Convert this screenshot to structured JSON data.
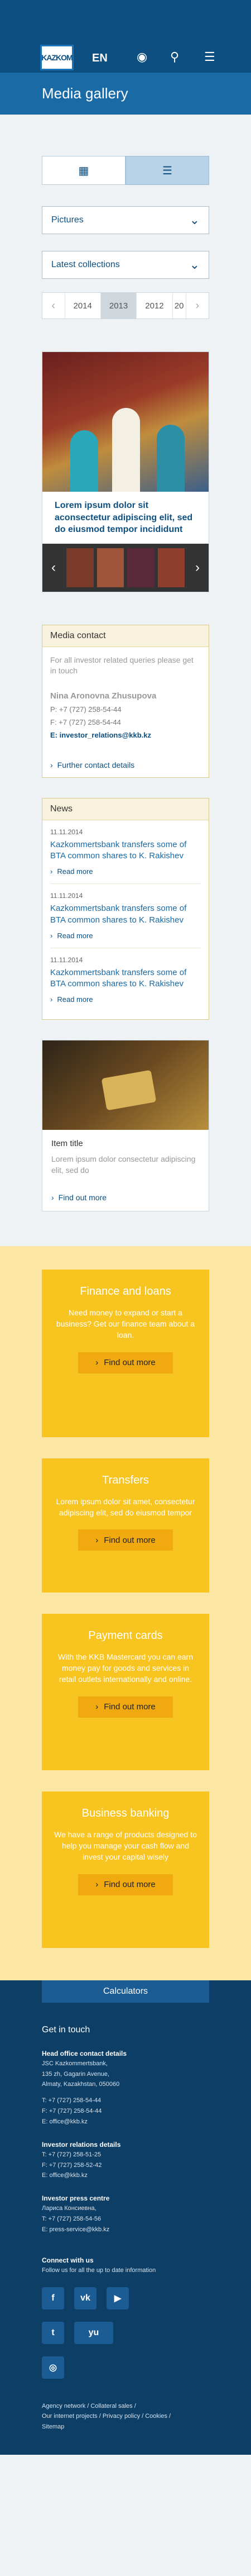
{
  "header": {
    "logo_text": "KAZKOM",
    "lang": "EN",
    "icons": [
      "map-pin-icon",
      "search-icon",
      "menu-icon"
    ],
    "page_title": "Media gallery"
  },
  "filters": {
    "type_select": "Pictures",
    "collection_select": "Latest collections",
    "years": [
      "2014",
      "2013",
      "2012",
      "20"
    ],
    "active_year": "2013"
  },
  "gallery": {
    "caption": "Lorem ipsum dolor sit aconsectetur adipiscing elit, sed do eiusmod tempor incididunt"
  },
  "media_contact": {
    "header": "Media contact",
    "intro": "For all investor related queries please get in touch",
    "name": "Nina Aronovna Zhusupova",
    "phone": "P: +7 (727) 258-54-44",
    "fax": "F: +7 (727) 258-54-44",
    "email": "E: investor_relations@kkb.kz",
    "more": "Further contact details"
  },
  "news": {
    "header": "News",
    "items": [
      {
        "date": "11.11.2014",
        "title": "Kazkommertsbank transfers some of BTA common shares to K. Rakishev",
        "more": "Read more"
      },
      {
        "date": "11.11.2014",
        "title": "Kazkommertsbank transfers some of BTA common shares to K. Rakishev",
        "more": "Read more"
      },
      {
        "date": "11.11.2014",
        "title": "Kazkommertsbank transfers some of BTA common shares to K. Rakishev",
        "more": "Read more"
      }
    ]
  },
  "item_card": {
    "title": "Item title",
    "text": "Lorem ipsum dolor consectetur adipiscing elit, sed do",
    "more": "Find out more"
  },
  "promos": [
    {
      "title": "Finance and loans",
      "text": "Need money to expand or start a business? Get our finance team about a loan.",
      "button": "Find out more"
    },
    {
      "title": "Transfers",
      "text": "Lorem ipsum dolor sit amet, consectetur adipiscing elit, sed do eiusmod tempor",
      "button": "Find out more"
    },
    {
      "title": "Payment cards",
      "text": "With the KKB Mastercard you can earn money pay for goods and services in retail outlets internationally and online.",
      "button": "Find out more"
    },
    {
      "title": "Business banking",
      "text": "We have a range of products designed to help you manage your cash flow and invest your capital wisely",
      "button": "Find out more"
    }
  ],
  "footer": {
    "calculators": "Calculators",
    "get_in_touch": "Get in touch",
    "head_office_title": "Head office contact details",
    "head_office_lines": [
      "JSC Kazkommertsbank,",
      "135 zh, Gagarin Avenue,",
      "Almaty, Kazakhstan, 050060"
    ],
    "head_office_phones": [
      "T: +7 (727) 258-54-44",
      "F: +7 (727) 258-54-44",
      "E: office@kkb.kz"
    ],
    "investor_title": "Investor relations details",
    "investor_lines": [
      "T: +7 (727) 258-51-25",
      "F: +7 (727) 258-52-42",
      "E: office@kkb.kz"
    ],
    "press_title": "Investor press centre",
    "press_lines": [
      "Лариса Консиевна,",
      "T: +7 (727) 258-54-56",
      "E: press-service@kkb.kz"
    ],
    "connect_title": "Connect with us",
    "connect_text": "Follow us for all the up to date information",
    "social_row1": [
      "f",
      "vk",
      "▶"
    ],
    "social_row2": [
      "t",
      "yu"
    ],
    "social_row3": [
      "◎"
    ],
    "links_line1": "Agency network  /  Collateral sales  /",
    "links_line2": "Our internet projects  /  Privacy policy  /  Cookies  /",
    "links_line3": "Sitemap"
  }
}
